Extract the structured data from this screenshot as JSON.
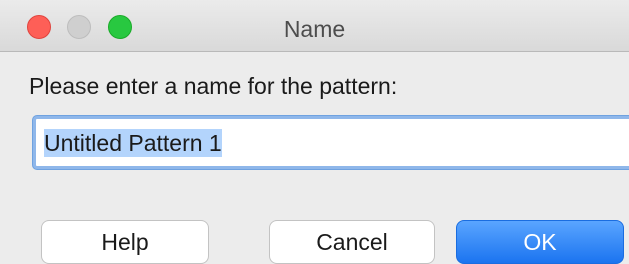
{
  "window": {
    "title": "Name"
  },
  "dialog": {
    "prompt": "Please enter a name for the pattern:",
    "name_value": "Untitled Pattern 1"
  },
  "buttons": {
    "help": "Help",
    "cancel": "Cancel",
    "ok": "OK"
  },
  "colors": {
    "close": "#fe5f57",
    "minimize": "#cfcfcf",
    "zoom": "#28c840",
    "accent": "#1b74f0",
    "selection": "#b3d4fc"
  }
}
